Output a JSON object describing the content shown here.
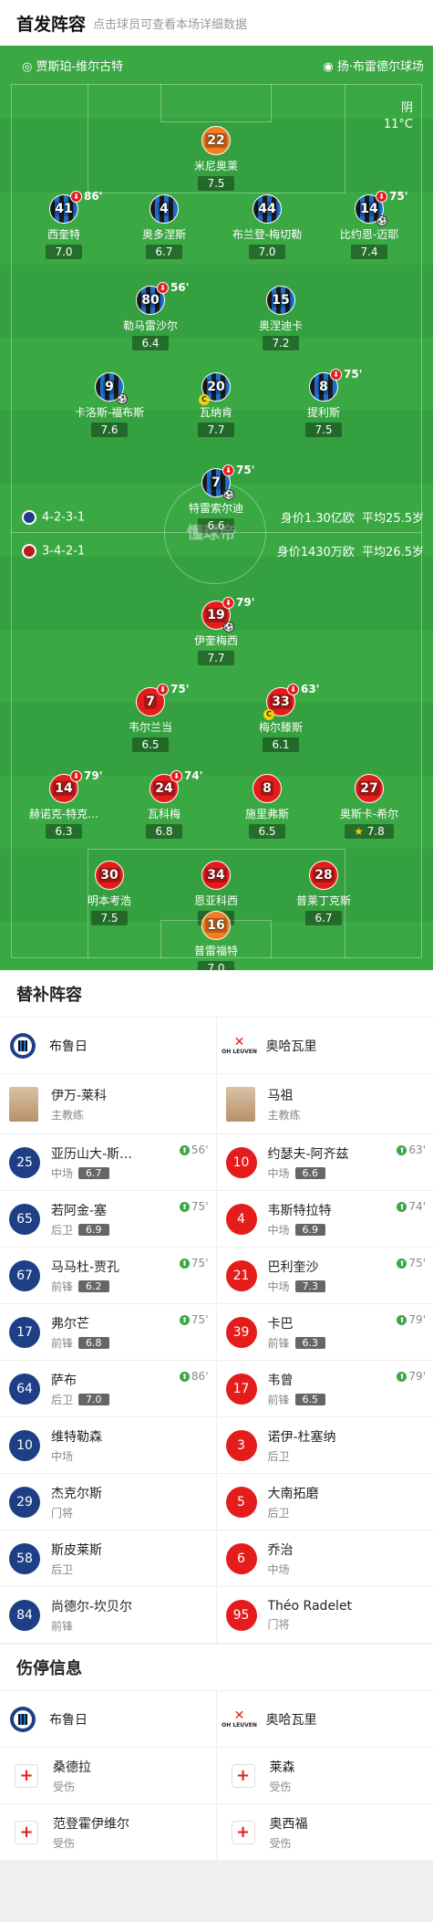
{
  "header": {
    "title": "首发阵容",
    "subtitle": "点击球员可查看本场详细数据"
  },
  "pitch": {
    "stadium": "贾斯珀-维尔古特",
    "referee": "扬·布雷德尔球场",
    "weather": "阴",
    "temp": "11°C",
    "watermark": "懂球帝",
    "home_formation": "4-2-3-1",
    "home_value": "身价1.30亿欧",
    "home_age": "平均25.5岁",
    "away_formation": "3-4-2-1",
    "away_value": "身价1430万欧",
    "away_age": "平均26.5岁"
  },
  "home_players": [
    {
      "num": "22",
      "name": "米尼奥莱",
      "rating": "7.5",
      "kit": "or"
    },
    {
      "num": "41",
      "name": "西奎特",
      "rating": "7.0",
      "kit": "bl",
      "sub": "86'"
    },
    {
      "num": "4",
      "name": "奥多涅斯",
      "rating": "6.7",
      "kit": "bl"
    },
    {
      "num": "44",
      "name": "布兰登-梅切勒",
      "rating": "7.0",
      "kit": "bl"
    },
    {
      "num": "14",
      "name": "比约恩-迈耶",
      "rating": "7.4",
      "kit": "bl",
      "sub": "75'"
    },
    {
      "num": "80",
      "name": "勒马雷沙尔",
      "rating": "6.4",
      "kit": "bl",
      "sub": "56'"
    },
    {
      "num": "15",
      "name": "奥涅迪卡",
      "rating": "7.2",
      "kit": "bl"
    },
    {
      "num": "9",
      "name": "卡洛斯-福布斯",
      "rating": "7.6",
      "kit": "bl"
    },
    {
      "num": "20",
      "name": "瓦纳肯",
      "rating": "7.7",
      "kit": "bl"
    },
    {
      "num": "8",
      "name": "提利斯",
      "rating": "7.5",
      "kit": "bl",
      "sub": "75'"
    },
    {
      "num": "7",
      "name": "特雷索尔迪",
      "rating": "6.6",
      "kit": "bl",
      "sub": "75'"
    }
  ],
  "away_players": [
    {
      "num": "19",
      "name": "伊奎梅西",
      "rating": "7.7",
      "kit": "rd",
      "sub": "79'"
    },
    {
      "num": "7",
      "name": "韦尔兰当",
      "rating": "6.5",
      "kit": "rd",
      "sub": "75'"
    },
    {
      "num": "33",
      "name": "梅尔滕斯",
      "rating": "6.1",
      "kit": "rd",
      "sub": "63'"
    },
    {
      "num": "14",
      "name": "赫诺克-特克…",
      "rating": "6.3",
      "kit": "rd",
      "sub": "79'"
    },
    {
      "num": "24",
      "name": "瓦科梅",
      "rating": "6.8",
      "kit": "rd",
      "sub": "74'"
    },
    {
      "num": "8",
      "name": "施里弗斯",
      "rating": "6.5",
      "kit": "rd"
    },
    {
      "num": "27",
      "name": "奥斯卡-希尔",
      "rating": "7.8",
      "kit": "rd"
    },
    {
      "num": "30",
      "name": "明本考浩",
      "rating": "7.5",
      "kit": "rd"
    },
    {
      "num": "34",
      "name": "恩亚科西",
      "rating": "6.3",
      "kit": "rd"
    },
    {
      "num": "28",
      "name": "普莱丁克斯",
      "rating": "6.7",
      "kit": "rd"
    },
    {
      "num": "16",
      "name": "普雷福特",
      "rating": "7.0",
      "kit": "or"
    }
  ],
  "subs": {
    "title": "替补阵容",
    "home_team": "布鲁日",
    "away_team": "奥哈瓦里",
    "away_logo_text": "OH LEUVEN",
    "home_coach": {
      "name": "伊万-莱科",
      "role": "主教练"
    },
    "away_coach": {
      "name": "马祖",
      "role": "主教练"
    },
    "home": [
      {
        "num": "25",
        "name": "亚历山大-斯…",
        "pos": "中场",
        "rating": "6.7",
        "sub": "56'"
      },
      {
        "num": "65",
        "name": "若阿金-塞",
        "pos": "后卫",
        "rating": "6.9",
        "sub": "75'"
      },
      {
        "num": "67",
        "name": "马马杜-贾孔",
        "pos": "前锋",
        "rating": "6.2",
        "sub": "75'"
      },
      {
        "num": "17",
        "name": "弗尔芒",
        "pos": "前锋",
        "rating": "6.8",
        "sub": "75'"
      },
      {
        "num": "64",
        "name": "萨布",
        "pos": "后卫",
        "rating": "7.0",
        "sub": "86'"
      },
      {
        "num": "10",
        "name": "维特勒森",
        "pos": "中场",
        "rating": "",
        "sub": ""
      },
      {
        "num": "29",
        "name": "杰克尔斯",
        "pos": "门将",
        "rating": "",
        "sub": ""
      },
      {
        "num": "58",
        "name": "斯皮莱斯",
        "pos": "后卫",
        "rating": "",
        "sub": ""
      },
      {
        "num": "84",
        "name": "尚德尔-坎贝尔",
        "pos": "前锋",
        "rating": "",
        "sub": ""
      }
    ],
    "away": [
      {
        "num": "10",
        "name": "约瑟夫-阿齐兹",
        "pos": "中场",
        "rating": "6.6",
        "sub": "63'"
      },
      {
        "num": "4",
        "name": "韦斯特拉特",
        "pos": "中场",
        "rating": "6.9",
        "sub": "74'"
      },
      {
        "num": "21",
        "name": "巴利奎沙",
        "pos": "中场",
        "rating": "7.3",
        "sub": "75'"
      },
      {
        "num": "39",
        "name": "卡巴",
        "pos": "前锋",
        "rating": "6.3",
        "sub": "79'"
      },
      {
        "num": "17",
        "name": "韦曾",
        "pos": "前锋",
        "rating": "6.5",
        "sub": "79'"
      },
      {
        "num": "3",
        "name": "诺伊-杜塞纳",
        "pos": "后卫",
        "rating": "",
        "sub": ""
      },
      {
        "num": "5",
        "name": "大南拓磨",
        "pos": "后卫",
        "rating": "",
        "sub": ""
      },
      {
        "num": "6",
        "name": "乔治",
        "pos": "中场",
        "rating": "",
        "sub": ""
      },
      {
        "num": "95",
        "name": "Théo Radelet",
        "pos": "门将",
        "rating": "",
        "sub": ""
      }
    ]
  },
  "injuries": {
    "title": "伤停信息",
    "home_team": "布鲁日",
    "away_team": "奥哈瓦里",
    "home": [
      {
        "name": "桑德拉",
        "status": "受伤"
      },
      {
        "name": "范登霍伊维尔",
        "status": "受伤"
      }
    ],
    "away": [
      {
        "name": "莱森",
        "status": "受伤"
      },
      {
        "name": "奥西福",
        "status": "受伤"
      }
    ]
  }
}
